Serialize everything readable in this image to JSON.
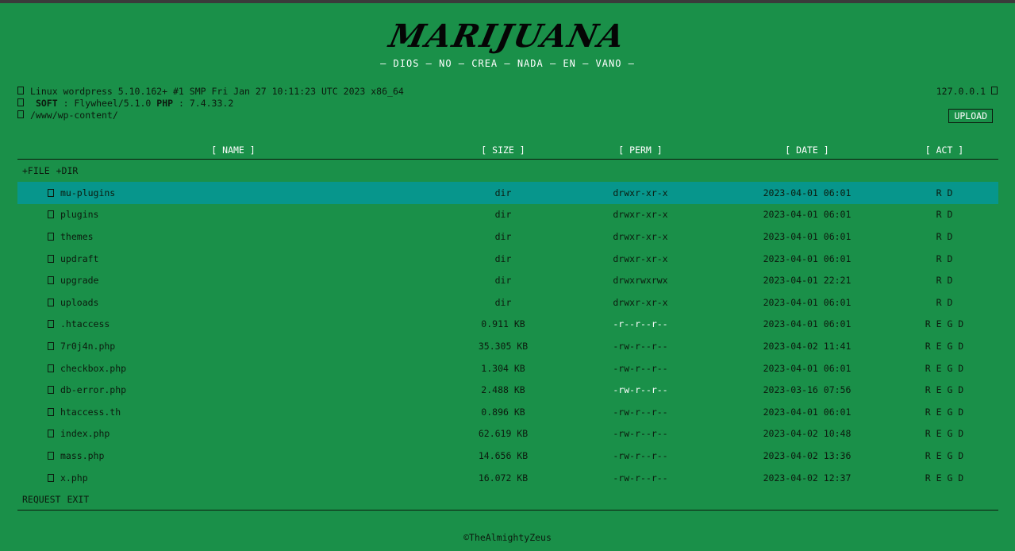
{
  "header": {
    "logo": "MARIJUANA",
    "tagline": "— DIOS — NO — CREA — NADA — EN — VANO —"
  },
  "system": {
    "uname": "Linux wordpress 5.10.162+ #1 SMP Fri Jan 27 10:11:23 UTC 2023 x86_64",
    "soft_label": "SOFT",
    "soft_value": ": Flywheel/5.1.0",
    "php_label": "PHP",
    "php_value": ": 7.4.33.2",
    "path": "/www/wp-content/",
    "ip": "127.0.0.1"
  },
  "upload_label": "UPLOAD",
  "columns": {
    "name": "[ NAME ]",
    "size": "[ SIZE ]",
    "perm": "[ PERM ]",
    "date": "[ DATE ]",
    "act": "[ ACT ]"
  },
  "new_links": {
    "file": "+FILE",
    "dir": "+DIR"
  },
  "rows": [
    {
      "name": "mu-plugins",
      "size": "dir",
      "perm": "drwxr-xr-x",
      "date": "2023-04-01 06:01",
      "act": "R D",
      "type": "dir"
    },
    {
      "name": "plugins",
      "size": "dir",
      "perm": "drwxr-xr-x",
      "date": "2023-04-01 06:01",
      "act": "R D",
      "type": "dir"
    },
    {
      "name": "themes",
      "size": "dir",
      "perm": "drwxr-xr-x",
      "date": "2023-04-01 06:01",
      "act": "R D",
      "type": "dir"
    },
    {
      "name": "updraft",
      "size": "dir",
      "perm": "drwxr-xr-x",
      "date": "2023-04-01 06:01",
      "act": "R D",
      "type": "dir"
    },
    {
      "name": "upgrade",
      "size": "dir",
      "perm": "drwxrwxrwx",
      "date": "2023-04-01 22:21",
      "act": "R D",
      "type": "dir"
    },
    {
      "name": "uploads",
      "size": "dir",
      "perm": "drwxr-xr-x",
      "date": "2023-04-01 06:01",
      "act": "R D",
      "type": "dir"
    },
    {
      "name": ".htaccess",
      "size": "0.911 KB",
      "perm": "-r--r--r--",
      "date": "2023-04-01 06:01",
      "act": "R E G D",
      "type": "file",
      "perm_color": "#ffffff"
    },
    {
      "name": "7r0j4n.php",
      "size": "35.305 KB",
      "perm": "-rw-r--r--",
      "date": "2023-04-02 11:41",
      "act": "R E G D",
      "type": "file"
    },
    {
      "name": "checkbox.php",
      "size": "1.304 KB",
      "perm": "-rw-r--r--",
      "date": "2023-04-01 06:01",
      "act": "R E G D",
      "type": "file"
    },
    {
      "name": "db-error.php",
      "size": "2.488 KB",
      "perm": "-rw-r--r--",
      "date": "2023-03-16 07:56",
      "act": "R E G D",
      "type": "file",
      "perm_color": "#ffffff"
    },
    {
      "name": "htaccess.th",
      "size": "0.896 KB",
      "perm": "-rw-r--r--",
      "date": "2023-04-01 06:01",
      "act": "R E G D",
      "type": "file"
    },
    {
      "name": "index.php",
      "size": "62.619 KB",
      "perm": "-rw-r--r--",
      "date": "2023-04-02 10:48",
      "act": "R E G D",
      "type": "file"
    },
    {
      "name": "mass.php",
      "size": "14.656 KB",
      "perm": "-rw-r--r--",
      "date": "2023-04-02 13:36",
      "act": "R E G D",
      "type": "file"
    },
    {
      "name": "x.php",
      "size": "16.072 KB",
      "perm": "-rw-r--r--",
      "date": "2023-04-02 12:37",
      "act": "R E G D",
      "type": "file"
    }
  ],
  "footer_links": {
    "request": "REQUEST",
    "exit": "EXIT"
  },
  "copyright": "©TheAlmightyZeus",
  "colors": {
    "background": "#1a9049",
    "highlight_row": "#07968c",
    "text": "#0c1a0e",
    "accent_text": "#ffffff"
  }
}
